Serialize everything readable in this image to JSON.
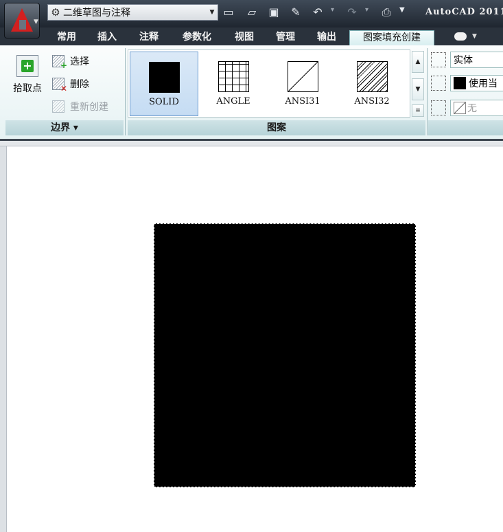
{
  "quick_access": {
    "workspace": "二维草图与注释",
    "app_title": "AutoCAD 2011"
  },
  "tabs": [
    "常用",
    "插入",
    "注释",
    "参数化",
    "视图",
    "管理",
    "输出",
    "图案填充创建"
  ],
  "boundary_panel": {
    "pick_points": "拾取点",
    "select": "选择",
    "remove": "删除",
    "recreate": "重新创建",
    "footer": "边界 ▾"
  },
  "pattern_panel": {
    "patterns": [
      "SOLID",
      "ANGLE",
      "ANSI31",
      "ANSI32"
    ],
    "selected": "SOLID",
    "footer": "图案"
  },
  "properties_panel": {
    "hatch_type": "实体",
    "hatch_color": "使用当",
    "background_color": "无"
  },
  "colors": {
    "accent_red": "#d3201f",
    "active_tab": "#e4f4f5",
    "selected_swatch": "#c5dcf3",
    "hatch_fill": "#000000"
  }
}
